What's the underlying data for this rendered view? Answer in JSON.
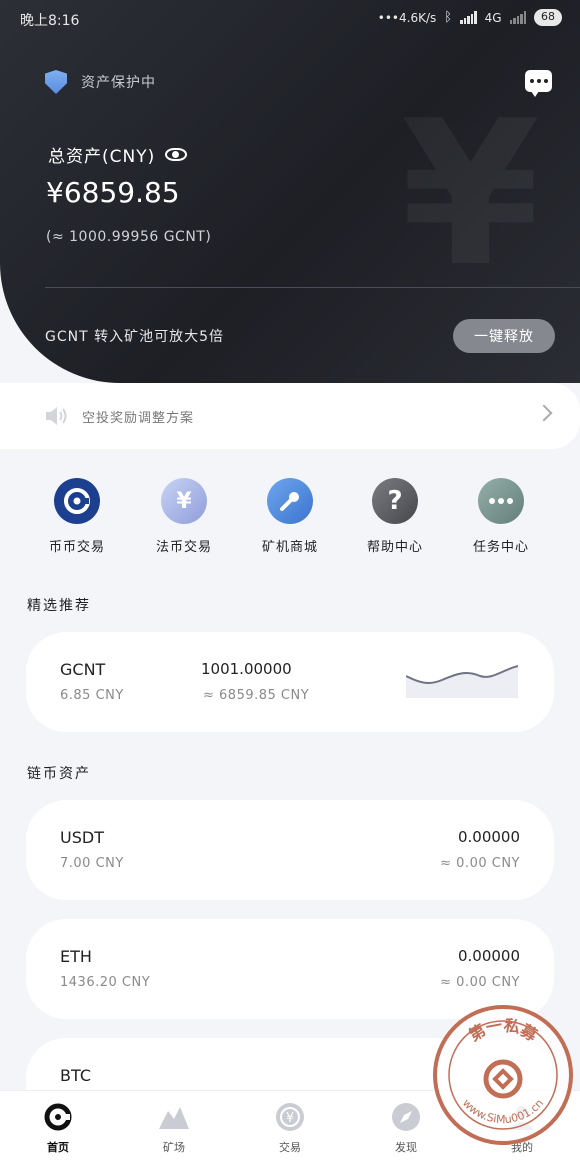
{
  "status_bar": {
    "time": "晚上8:16",
    "network_speed": "4.6K/s",
    "network_type": "4G",
    "battery": "68"
  },
  "header": {
    "protect_label": "资产保护中",
    "total_label": "总资产(CNY)",
    "total_value": "¥6859.85",
    "total_approx": "(≈ 1000.99956 GCNT)",
    "promo_text": "GCNT 转入矿池可放大5倍",
    "release_button": "一键释放"
  },
  "notice": {
    "text": "空投奖励调整方案"
  },
  "actions": [
    {
      "label": "币币交易",
      "icon": "coin-exchange-icon",
      "color": "#1d3f8f"
    },
    {
      "label": "法币交易",
      "icon": "yen-icon",
      "color": "#a9b5e6"
    },
    {
      "label": "矿机商城",
      "icon": "miner-icon",
      "color": "#4f8be0"
    },
    {
      "label": "帮助中心",
      "icon": "help-icon",
      "color": "#5a5c62"
    },
    {
      "label": "任务中心",
      "icon": "more-icon",
      "color": "#79968f"
    }
  ],
  "featured": {
    "title": "精选推荐",
    "item": {
      "symbol": "GCNT",
      "price": "6.85  CNY",
      "amount": "1001.00000",
      "approx": "≈  6859.85  CNY"
    }
  },
  "assets": {
    "title": "链币资产",
    "items": [
      {
        "symbol": "USDT",
        "price": "7.00  CNY",
        "amount": "0.00000",
        "approx": "≈  0.00  CNY"
      },
      {
        "symbol": "ETH",
        "price": "1436.20  CNY",
        "amount": "0.00000",
        "approx": "≈  0.00  CNY"
      },
      {
        "symbol": "BTC",
        "price": "",
        "amount": "",
        "approx": ""
      }
    ]
  },
  "bottom_nav": [
    {
      "label": "首页",
      "icon": "home-icon",
      "active": true
    },
    {
      "label": "矿场",
      "icon": "mountain-icon",
      "active": false
    },
    {
      "label": "交易",
      "icon": "trade-icon",
      "active": false
    },
    {
      "label": "发现",
      "icon": "compass-icon",
      "active": false
    },
    {
      "label": "我的",
      "icon": "user-icon",
      "active": false
    }
  ],
  "watermark": {
    "top_text": "第一私募",
    "bottom_text": "www.SiMu001.cn"
  }
}
